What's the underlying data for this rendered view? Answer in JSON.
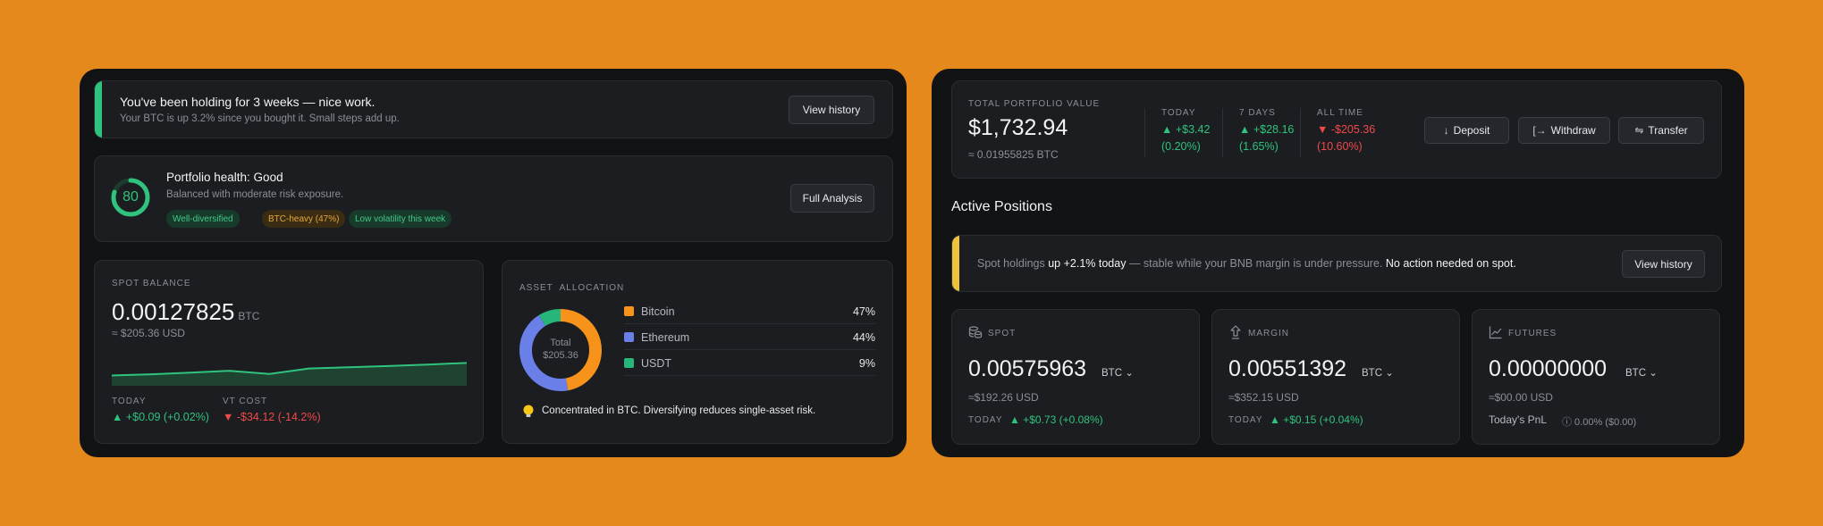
{
  "left": {
    "holding_banner": {
      "title": "You've been holding for 3 weeks — nice work.",
      "subtitle": "Your BTC is up 3.2% since you bought it. Small steps add up.",
      "button": "View history"
    },
    "health": {
      "score": "80",
      "score_fraction": 0.8,
      "title": "Portfolio health: Good",
      "subtitle": "Balanced with moderate risk exposure.",
      "tags": [
        "Well-diversified",
        "BTC-heavy (47%)",
        "Low volatility this week"
      ],
      "button": "Full Analysis"
    },
    "spot_balance": {
      "label": "SPOT BALANCE",
      "value": "0.00127825",
      "unit": "BTC",
      "usd": "≈ $205.36 USD",
      "today_label": "TODAY",
      "today_value": "▲ +$0.09 (+0.02%)",
      "cost_label": "VT COST",
      "cost_value": "▼ -$34.12 (-14.2%)"
    },
    "allocation": {
      "label": "ASSET  ALLOCATION",
      "total_label": "Total",
      "total_value": "$205.36",
      "items": [
        {
          "name": "Bitcoin",
          "pct": "47%",
          "fraction": 0.47,
          "color": "#F7931A"
        },
        {
          "name": "Ethereum",
          "pct": "44%",
          "fraction": 0.44,
          "color": "#6B7FE8"
        },
        {
          "name": "USDT",
          "pct": "9%",
          "fraction": 0.09,
          "color": "#26B67A"
        }
      ],
      "tip": "Concentrated in BTC. Diversifying reduces single-asset risk."
    }
  },
  "right": {
    "portfolio": {
      "label": "TOTAL PORTFOLIO VALUE",
      "value": "$1,732.94",
      "btc": "≈ 0.01955825 BTC",
      "stats": [
        {
          "label": "TODAY",
          "v1": "▲ +$3.42",
          "v2": "(0.20%)",
          "trend": "up"
        },
        {
          "label": "7 DAYS",
          "v1": "▲ +$28.16",
          "v2": "(1.65%)",
          "trend": "up"
        },
        {
          "label": "ALL TIME",
          "v1": "▼ -$205.36",
          "v2": "(10.60%)",
          "trend": "down"
        }
      ],
      "buttons": {
        "deposit": "Deposit",
        "withdraw": "Withdraw",
        "transfer": "Transfer"
      }
    },
    "active_title": "Active Positions",
    "spot_banner": {
      "t1": "Spot holdings ",
      "t2": "up +2.1% today",
      "t3": " — stable while your BNB margin is under pressure. ",
      "t4": "No action needed on spot.",
      "button": "View history"
    },
    "positions": {
      "spot": {
        "label": "SPOT",
        "value": "0.00575963",
        "currency": "BTC ⌄",
        "usd": "≈$192.26 USD",
        "today_label": "TODAY",
        "today_value": "▲ +$0.73 (+0.08%)"
      },
      "margin": {
        "label": "MARGIN",
        "value": "0.00551392",
        "currency": "BTC ⌄",
        "usd": "≈$352.15 USD",
        "today_label": "TODAY",
        "today_value": "▲ +$0.15 (+0.04%)"
      },
      "futures": {
        "label": "FUTURES",
        "value": "0.00000000",
        "currency": "BTC ⌄",
        "usd": "≈$00.00 USD",
        "pnl_label": "Today's PnL",
        "pnl_value": "ⓘ 0.00% ($0.00)"
      }
    }
  },
  "colors": {
    "background": "#E5891C",
    "panel": "#121315",
    "card": "#1B1D20",
    "green": "#2FC37E",
    "red": "#EF4A4A",
    "yellow": "#F0C23B"
  },
  "sparkline": {
    "values": [
      0.2,
      0.28,
      0.38,
      0.5,
      0.3,
      0.65,
      0.72,
      0.8,
      0.9,
      1.0
    ]
  }
}
